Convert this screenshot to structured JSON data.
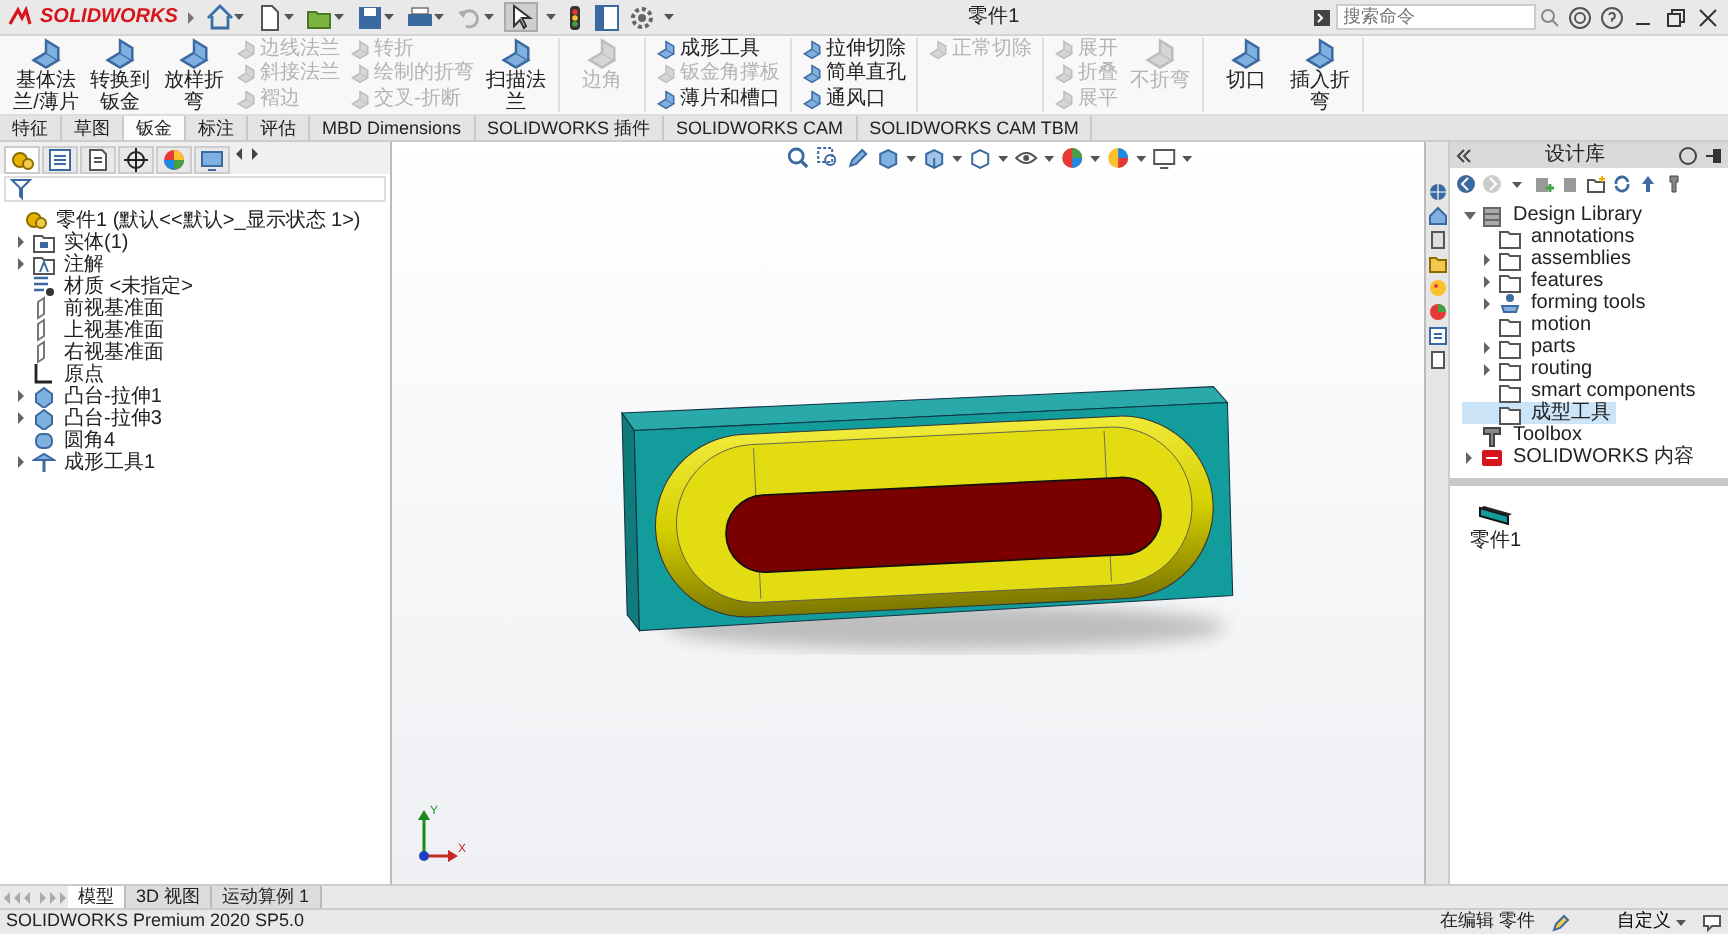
{
  "title_bar": {
    "logo": "SOLIDWORKS",
    "title": "零件1",
    "search": {
      "placeholder": "搜索命令"
    }
  },
  "ribbon": {
    "groups": [
      {
        "columns": [
          {
            "kind": "large",
            "items": [
              {
                "label": "基体法兰/薄片",
                "disabled": false
              }
            ]
          },
          {
            "kind": "large",
            "items": [
              {
                "label": "转换到钣金",
                "disabled": false
              }
            ]
          },
          {
            "kind": "large",
            "items": [
              {
                "label": "放样折弯",
                "disabled": false
              }
            ]
          },
          {
            "kind": "stack",
            "items": [
              {
                "label": "边线法兰",
                "disabled": true
              },
              {
                "label": "斜接法兰",
                "disabled": true
              },
              {
                "label": "褶边",
                "disabled": true
              }
            ]
          },
          {
            "kind": "stack",
            "items": [
              {
                "label": "转折",
                "disabled": true
              },
              {
                "label": "绘制的折弯",
                "disabled": true
              },
              {
                "label": "交叉-折断",
                "disabled": true
              }
            ]
          },
          {
            "kind": "large",
            "items": [
              {
                "label": "扫描法兰",
                "disabled": false
              }
            ]
          }
        ]
      },
      {
        "columns": [
          {
            "kind": "large",
            "items": [
              {
                "label": "边角",
                "disabled": true
              }
            ]
          }
        ]
      },
      {
        "columns": [
          {
            "kind": "stack",
            "items": [
              {
                "label": "成形工具",
                "disabled": false
              },
              {
                "label": "钣金角撑板",
                "disabled": true
              },
              {
                "label": "薄片和槽口",
                "disabled": false
              }
            ]
          }
        ]
      },
      {
        "columns": [
          {
            "kind": "stack",
            "items": [
              {
                "label": "拉伸切除",
                "disabled": false
              },
              {
                "label": "简单直孔",
                "disabled": false
              },
              {
                "label": "通风口",
                "disabled": false
              }
            ]
          }
        ]
      },
      {
        "columns": [
          {
            "kind": "stack",
            "items": [
              {
                "label": "正常切除",
                "disabled": true
              }
            ]
          }
        ]
      },
      {
        "columns": [
          {
            "kind": "stack",
            "items": [
              {
                "label": "展开",
                "disabled": true
              },
              {
                "label": "折叠",
                "disabled": true
              },
              {
                "label": "展平",
                "disabled": true
              }
            ]
          },
          {
            "kind": "large",
            "items": [
              {
                "label": "不折弯",
                "disabled": true
              }
            ]
          }
        ]
      },
      {
        "columns": [
          {
            "kind": "large",
            "items": [
              {
                "label": "切口",
                "disabled": false
              }
            ]
          },
          {
            "kind": "large",
            "items": [
              {
                "label": "插入折弯",
                "disabled": false
              }
            ]
          }
        ]
      }
    ]
  },
  "command_tabs": [
    {
      "label": "特征",
      "selected": false
    },
    {
      "label": "草图",
      "selected": false
    },
    {
      "label": "钣金",
      "selected": true
    },
    {
      "label": "标注",
      "selected": false
    },
    {
      "label": "评估",
      "selected": false
    },
    {
      "label": "MBD Dimensions",
      "selected": false
    },
    {
      "label": "SOLIDWORKS 插件",
      "selected": false
    },
    {
      "label": "SOLIDWORKS CAM",
      "selected": false
    },
    {
      "label": "SOLIDWORKS CAM TBM",
      "selected": false
    }
  ],
  "feature_panel": {
    "tabs": [
      {
        "selected": true
      },
      {
        "selected": false
      },
      {
        "selected": false
      },
      {
        "selected": false
      },
      {
        "selected": false
      },
      {
        "selected": false
      }
    ]
  },
  "feature_tree": {
    "items": [
      {
        "label": "零件1 (默认<<默认>_显示状态 1>)",
        "kind": "part",
        "children": [
          {
            "label": "实体(1)",
            "kind": "bodies",
            "expanded": false
          },
          {
            "label": "注解",
            "kind": "annotations",
            "expanded": false
          },
          {
            "label": "材质 <未指定>",
            "kind": "material"
          },
          {
            "label": "前视基准面",
            "kind": "plane"
          },
          {
            "label": "上视基准面",
            "kind": "plane"
          },
          {
            "label": "右视基准面",
            "kind": "plane"
          },
          {
            "label": "原点",
            "kind": "origin"
          },
          {
            "label": "凸台-拉伸1",
            "kind": "extrude",
            "expanded": false
          },
          {
            "label": "凸台-拉伸3",
            "kind": "extrude",
            "expanded": false
          },
          {
            "label": "圆角4",
            "kind": "fillet"
          },
          {
            "label": "成形工具1",
            "kind": "forming-tool",
            "expanded": false
          }
        ]
      }
    ]
  },
  "viewport": {
    "triad": {
      "y": "Y",
      "x": "X"
    }
  },
  "design_library": {
    "title": "设计库",
    "tree": [
      {
        "label": "Design Library",
        "kind": "library",
        "expanded": true,
        "selected": false,
        "children": [
          {
            "label": "annotations",
            "kind": "folder",
            "selected": false
          },
          {
            "label": "assemblies",
            "kind": "folder",
            "expanded": false,
            "selected": false
          },
          {
            "label": "features",
            "kind": "folder",
            "expanded": false,
            "selected": false
          },
          {
            "label": "forming tools",
            "kind": "tool",
            "expanded": false,
            "selected": false
          },
          {
            "label": "motion",
            "kind": "folder",
            "selected": false
          },
          {
            "label": "parts",
            "kind": "folder",
            "expanded": false,
            "selected": false
          },
          {
            "label": "routing",
            "kind": "folder",
            "expanded": false,
            "selected": false
          },
          {
            "label": "smart components",
            "kind": "folder",
            "selected": false
          },
          {
            "label": "成型工具",
            "kind": "folder",
            "selected": true
          }
        ]
      },
      {
        "label": "Toolbox",
        "kind": "toolbox",
        "selected": false
      },
      {
        "label": "SOLIDWORKS 内容",
        "kind": "content",
        "expanded": false,
        "selected": false
      }
    ],
    "files": [
      {
        "label": "零件1"
      }
    ]
  },
  "bottom_tabs": [
    {
      "label": "模型",
      "selected": true
    },
    {
      "label": "3D 视图",
      "selected": false
    },
    {
      "label": "运动算例 1",
      "selected": false
    }
  ],
  "status_bar": {
    "product": "SOLIDWORKS Premium 2020 SP5.0",
    "mode": "在编辑 零件",
    "units": "自定义"
  }
}
